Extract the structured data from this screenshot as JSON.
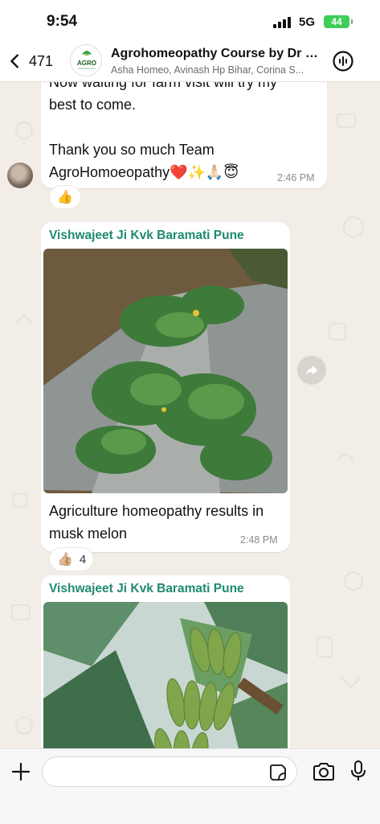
{
  "status_bar": {
    "time": "9:54",
    "network": "5G",
    "battery": "44"
  },
  "header": {
    "back_count": "471",
    "avatar_text": "AGRO",
    "title": "Agrohomeopathy Course by Dr V...",
    "subtitle": "Asha Homeo, Avinash Hp Bihar, Corina S..."
  },
  "messages": [
    {
      "partial_line": "Now waiting for farm visit will try my",
      "lines": [
        "best to come.",
        "",
        "Thank you so much Team",
        "AgroHomoeopathy❤️✨🙏🏻😇"
      ],
      "time": "2:46 PM",
      "reaction": "👍"
    },
    {
      "sender": "Vishwajeet Ji Kvk Baramati Pune",
      "image_subject": "musk melon plants on mulch",
      "caption_lines": [
        "Agriculture homeopathy results in",
        "musk melon"
      ],
      "time": "2:48 PM",
      "reaction": "👍🏼",
      "reaction_count": "4"
    },
    {
      "sender": "Vishwajeet Ji Kvk Baramati Pune",
      "image_subject": "banana bunch on plant"
    }
  ],
  "composer": {
    "placeholder": ""
  },
  "colors": {
    "sender_name": "#1f8a70",
    "chat_background": "#f2ede6",
    "bubble": "#ffffff",
    "battery": "#3fcd59"
  },
  "icons": [
    "back-chevron-icon",
    "audio-call-icon",
    "forward-icon",
    "chevron-down-icon",
    "plus-icon",
    "sticker-icon",
    "camera-icon",
    "microphone-icon"
  ]
}
